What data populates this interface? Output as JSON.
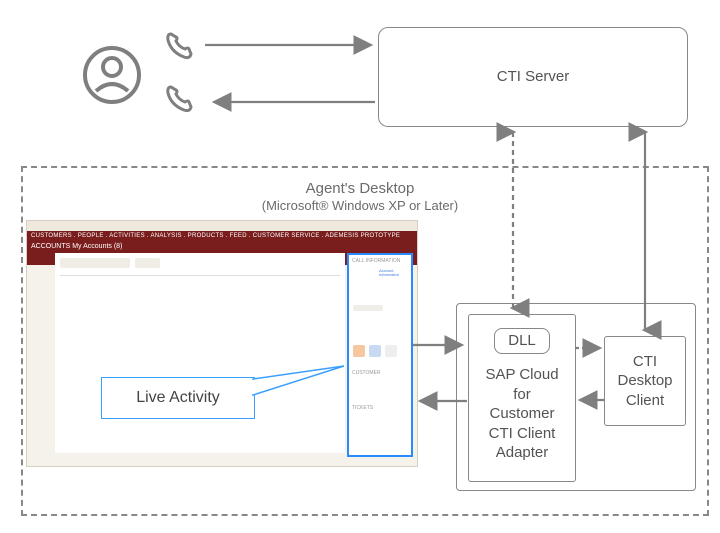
{
  "cti_server": {
    "label": "CTI Server"
  },
  "agent_desktop": {
    "title": "Agent's Desktop",
    "subtitle": "(Microsoft® Windows XP or Later)"
  },
  "sap_adapter": {
    "dll_label": "DLL",
    "label": "SAP Cloud\nfor\nCustomer\nCTI Client\nAdapter"
  },
  "cti_client": {
    "label": "CTI\nDesktop\nClient"
  },
  "callout": {
    "label": "Live Activity"
  },
  "screenshot_mock": {
    "nav_items": "CUSTOMERS . PEOPLE . ACTIVITIES . ANALYSIS . PRODUCTS . FEED . CUSTOMER SERVICE . ADEMESIS PROTOTYPE",
    "account_title": "ACCOUNTS My Accounts (8)",
    "panel_title": "CALL INFORMATION",
    "panel_link": "Account Information",
    "panel_section1": "CUSTOMER",
    "panel_section2": "TICKETS"
  },
  "icons": {
    "user": "user-icon",
    "phone_out": "phone-outgoing-icon",
    "phone_in": "phone-incoming-icon"
  }
}
